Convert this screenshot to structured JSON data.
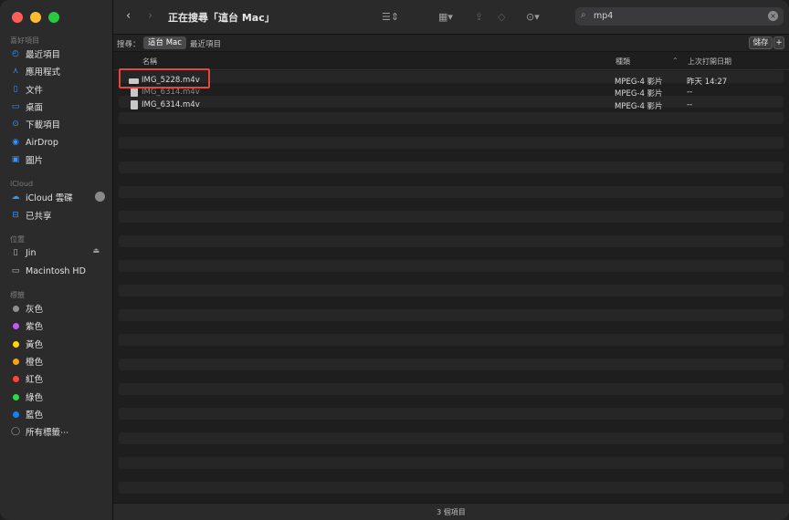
{
  "window": {
    "title": "正在搜尋「這台 Mac」"
  },
  "sidebar": {
    "favorites_header": "喜好項目",
    "favorites": [
      {
        "label": "最近項目",
        "icon": "clock-icon"
      },
      {
        "label": "應用程式",
        "icon": "applications-icon"
      },
      {
        "label": "文件",
        "icon": "document-icon"
      },
      {
        "label": "桌面",
        "icon": "desktop-icon"
      },
      {
        "label": "下載項目",
        "icon": "download-icon"
      },
      {
        "label": "AirDrop",
        "icon": "airdrop-icon"
      },
      {
        "label": "圖片",
        "icon": "photo-icon"
      }
    ],
    "icloud_header": "iCloud",
    "icloud": [
      {
        "label": "iCloud 雲碟",
        "icon": "cloud-icon"
      },
      {
        "label": "已共享",
        "icon": "shared-folder-icon"
      }
    ],
    "locations_header": "位置",
    "locations": [
      {
        "label": "Jin",
        "icon": "phone-icon"
      },
      {
        "label": "Macintosh HD",
        "icon": "disk-icon"
      }
    ],
    "tags_header": "標籤",
    "tags": [
      {
        "label": "灰色",
        "color": "#8e8e93"
      },
      {
        "label": "紫色",
        "color": "#bf5af2"
      },
      {
        "label": "黃色",
        "color": "#ffd60a"
      },
      {
        "label": "橙色",
        "color": "#ff9f0a"
      },
      {
        "label": "紅色",
        "color": "#ff453a"
      },
      {
        "label": "綠色",
        "color": "#32d74b"
      },
      {
        "label": "藍色",
        "color": "#0a84ff"
      }
    ],
    "all_tags": "所有標籤⋯"
  },
  "search": {
    "value": "mp4"
  },
  "scope": {
    "label": "搜尋：",
    "this_mac": "這台 Mac",
    "recents": "最近項目",
    "save": "儲存",
    "add": "+"
  },
  "columns": {
    "name": "名稱",
    "kind": "種類",
    "date": "上次打開日期"
  },
  "files": [
    {
      "name": "IMG_5228.m4v",
      "kind": "MPEG-4 影片",
      "date": "昨天 14:27"
    },
    {
      "name": "IMG_6314.m4v",
      "kind": "MPEG-4 影片",
      "date": "--"
    },
    {
      "name": "IMG_6314.m4v",
      "kind": "MPEG-4 影片",
      "date": "--"
    }
  ],
  "status": {
    "count": "3 個項目"
  }
}
